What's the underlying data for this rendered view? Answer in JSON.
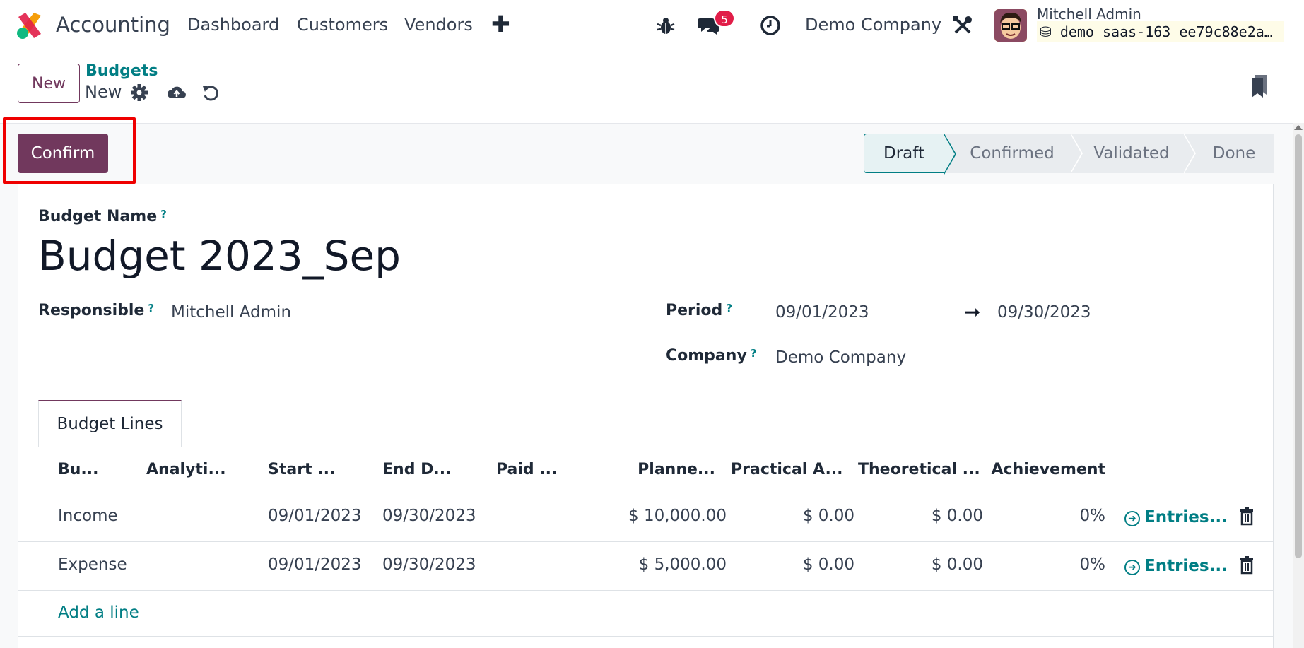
{
  "navbar": {
    "app_name": "Accounting",
    "menu": [
      "Dashboard",
      "Customers",
      "Vendors"
    ],
    "messages_count": "5",
    "company": "Demo Company",
    "user_name": "Mitchell Admin",
    "database": "demo_saas-163_ee79c88e2a…"
  },
  "control_panel": {
    "new_label": "New",
    "breadcrumb": "Budgets",
    "record_name": "New"
  },
  "form": {
    "confirm_label": "Confirm",
    "stages": [
      "Draft",
      "Confirmed",
      "Validated",
      "Done"
    ],
    "active_stage": "Draft",
    "labels": {
      "budget_name": "Budget Name",
      "responsible": "Responsible",
      "period": "Period",
      "company": "Company",
      "help": "?"
    },
    "budget_name": "Budget 2023_Sep",
    "responsible": "Mitchell Admin",
    "period_start": "09/01/2023",
    "period_end": "09/30/2023",
    "company": "Demo Company"
  },
  "tab": {
    "label": "Budget Lines"
  },
  "table": {
    "headers": [
      "Bu...",
      "Analyti...",
      "Start ...",
      "End D...",
      "Paid ...",
      "Planne...",
      "Practical A...",
      "Theoretical ...",
      "Achievement"
    ],
    "rows": [
      {
        "position": "Income",
        "analytic": "",
        "start": "09/01/2023",
        "end": "09/30/2023",
        "paid": "",
        "planned": "$ 10,000.00",
        "practical": "$ 0.00",
        "theoretical": "$ 0.00",
        "achievement": "0%",
        "entries": "Entries..."
      },
      {
        "position": "Expense",
        "analytic": "",
        "start": "09/01/2023",
        "end": "09/30/2023",
        "paid": "",
        "planned": "$ 5,000.00",
        "practical": "$ 0.00",
        "theoretical": "$ 0.00",
        "achievement": "0%",
        "entries": "Entries..."
      }
    ],
    "add_line": "Add a line"
  },
  "colors": {
    "primary": "#71385d",
    "accent": "#017e84",
    "badge": "#e11d48",
    "highlight": "#ef0000"
  },
  "icons": [
    "app-logo-icon",
    "bug-icon",
    "chat-icon",
    "clock-icon",
    "tools-icon",
    "gear-icon",
    "cloud-upload-icon",
    "undo-icon",
    "bookmark-icon",
    "trash-icon",
    "arrow-circle-right-icon"
  ]
}
